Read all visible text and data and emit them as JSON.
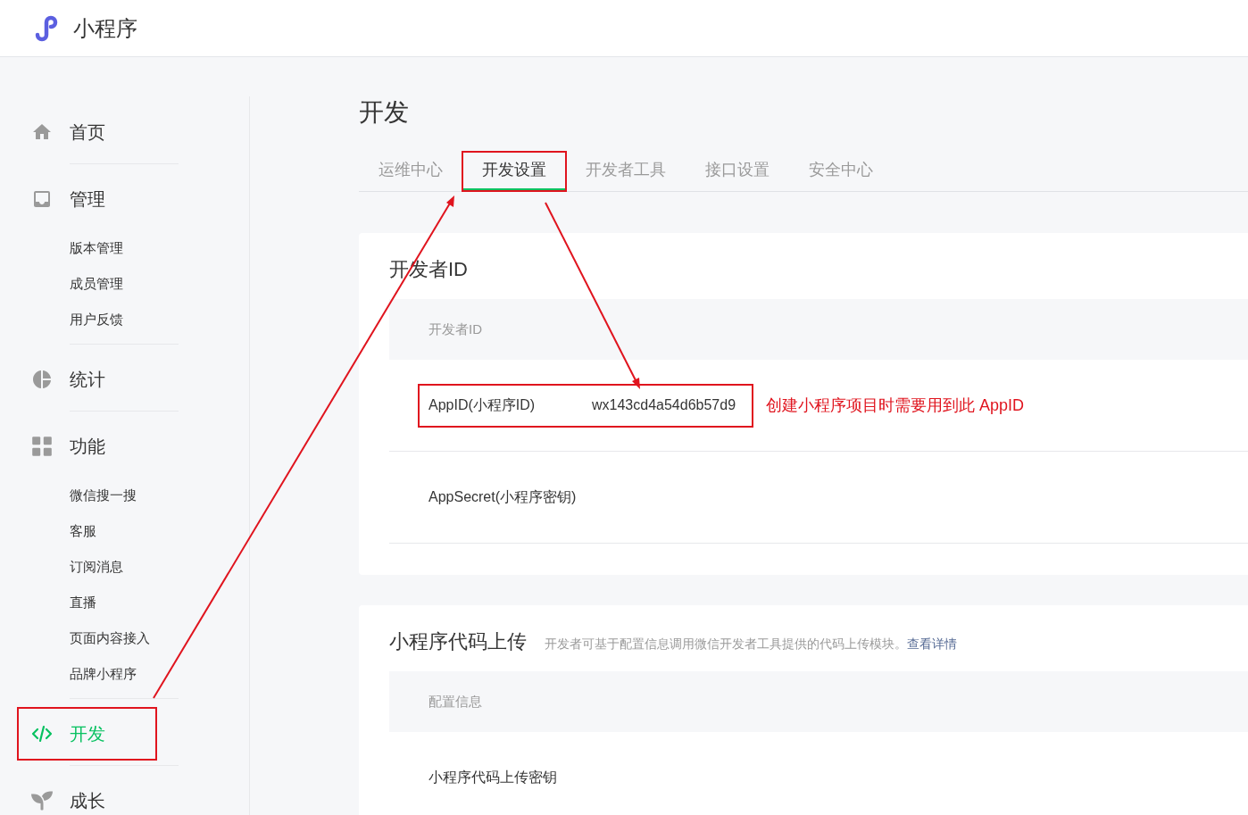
{
  "header": {
    "title": "小程序"
  },
  "sidebar": {
    "sections": [
      {
        "label": "首页",
        "selected": false,
        "highlighted": false
      },
      {
        "label": "管理",
        "selected": false,
        "highlighted": false,
        "children": [
          {
            "label": "版本管理",
            "selected": false
          },
          {
            "label": "成员管理",
            "selected": false
          },
          {
            "label": "用户反馈",
            "selected": false
          }
        ]
      },
      {
        "label": "统计",
        "selected": false,
        "highlighted": false
      },
      {
        "label": "功能",
        "selected": false,
        "highlighted": false,
        "children": [
          {
            "label": "微信搜一搜",
            "selected": false
          },
          {
            "label": "客服",
            "selected": false
          },
          {
            "label": "订阅消息",
            "selected": false
          },
          {
            "label": "直播",
            "selected": false
          },
          {
            "label": "页面内容接入",
            "selected": false
          },
          {
            "label": "品牌小程序",
            "selected": false
          }
        ]
      },
      {
        "label": "开发",
        "selected": true,
        "highlighted": true
      },
      {
        "label": "成长",
        "selected": false,
        "highlighted": false
      }
    ]
  },
  "page_title": "开发",
  "tabs": [
    {
      "label": "运维中心",
      "selected": false,
      "highlighted": false
    },
    {
      "label": "开发设置",
      "selected": true,
      "highlighted": true
    },
    {
      "label": "开发者工具",
      "selected": false,
      "highlighted": false
    },
    {
      "label": "接口设置",
      "selected": false,
      "highlighted": false
    },
    {
      "label": "安全中心",
      "selected": false,
      "highlighted": false
    }
  ],
  "cards": [
    {
      "title": "开发者ID",
      "table_header": "开发者ID",
      "rows": [
        {
          "label": "AppID(小程序ID)",
          "value": "wx143cd4a54d6b57d9",
          "highlighted": true,
          "note": "创建小程序项目时需要用到此 AppID"
        },
        {
          "label": "AppSecret(小程序密钥)",
          "highlighted": false
        }
      ]
    },
    {
      "title": "小程序代码上传",
      "description": "开发者可基于配置信息调用微信开发者工具提供的代码上传模块。",
      "link": "查看详情",
      "table_header": "配置信息",
      "rows": [
        {
          "label": "小程序代码上传密钥",
          "highlighted": false
        }
      ]
    }
  ]
}
